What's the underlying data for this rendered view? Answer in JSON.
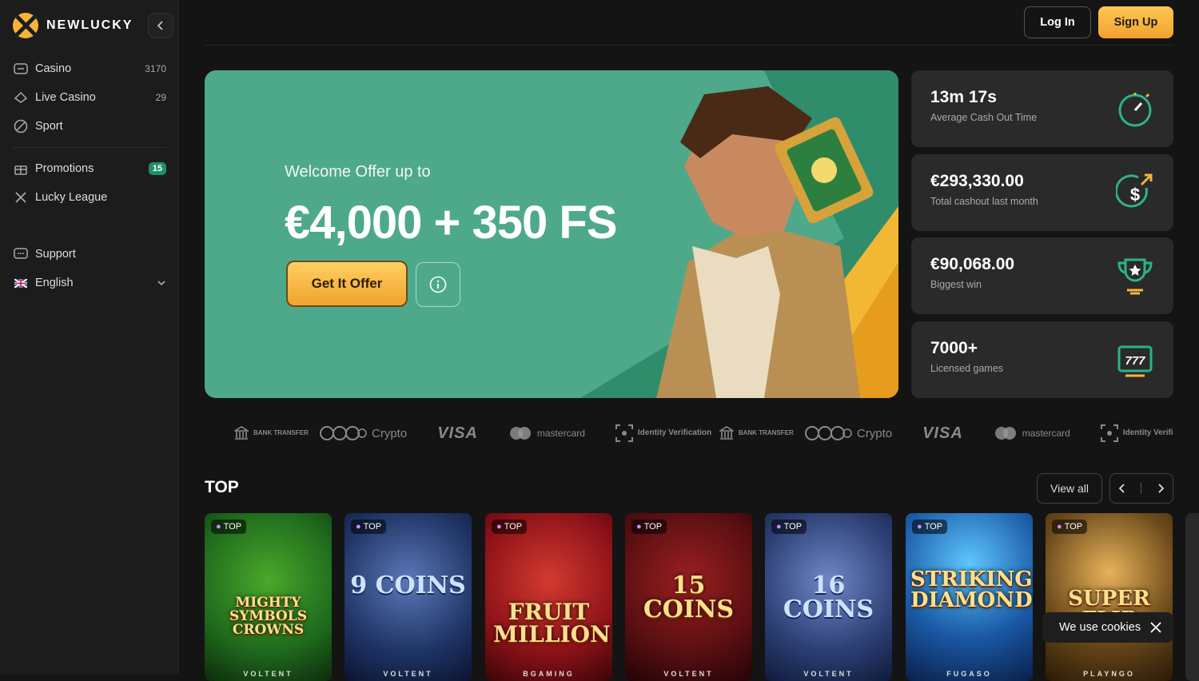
{
  "brand": {
    "name": "NEWLUCKY"
  },
  "nav": {
    "main": [
      {
        "label": "Casino",
        "count": "3170",
        "icon": "casino-icon"
      },
      {
        "label": "Live Casino",
        "count": "29",
        "icon": "live-casino-icon"
      },
      {
        "label": "Sport",
        "icon": "sport-icon"
      }
    ],
    "promo": [
      {
        "label": "Promotions",
        "badge": "15",
        "icon": "gift-icon"
      },
      {
        "label": "Lucky League",
        "icon": "league-icon"
      }
    ],
    "support": {
      "label": "Support"
    },
    "language": {
      "label": "English"
    }
  },
  "header": {
    "login": "Log In",
    "signup": "Sign Up"
  },
  "hero": {
    "subtitle": "Welcome Offer up to",
    "title": "€4,000 + 350 FS",
    "cta": "Get It Offer"
  },
  "stats": [
    {
      "value": "13m 17s",
      "label": "Average Cash Out Time",
      "icon": "stopwatch-icon"
    },
    {
      "value": "€293,330.00",
      "label": "Total cashout last month",
      "icon": "dollar-cashout-icon"
    },
    {
      "value": "€90,068.00",
      "label": "Biggest win",
      "icon": "trophy-icon"
    },
    {
      "value": "7000+",
      "label": "Licensed games",
      "icon": "slot-machine-icon"
    }
  ],
  "payments": [
    "Crypto",
    "VISA",
    "mastercard",
    "Identity Verification",
    "BANK TRANSFER"
  ],
  "top": {
    "title": "TOP",
    "view_all": "View all",
    "tag": "TOP"
  },
  "games": [
    {
      "title": "MIGHTY SYMBOLS CROWNS",
      "provider": "VOLTENT",
      "bg": "#1f6a1d"
    },
    {
      "title": "9 COINS",
      "provider": "VOLTENT",
      "bg": "#1f3566"
    },
    {
      "title": "FRUIT MILLION",
      "provider": "BGAMING",
      "bg": "#8d1218"
    },
    {
      "title": "15 COINS",
      "provider": "VOLTENT",
      "bg": "#5a0f12"
    },
    {
      "title": "16 COINS",
      "provider": "VOLTENT",
      "bg": "#2c3f74"
    },
    {
      "title": "STRIKING DIAMOND",
      "provider": "FUGASO",
      "bg": "#1a5aa6"
    },
    {
      "title": "SUPER FLIP",
      "provider": "PLAYNGO",
      "bg": "#6b4a1a"
    }
  ],
  "cookie": {
    "text": "We use cookies"
  },
  "colors": {
    "accent": "#f4b43a",
    "hero": "#4da98a",
    "card": "#2a2a2a",
    "badge": "#1f8f6b"
  }
}
